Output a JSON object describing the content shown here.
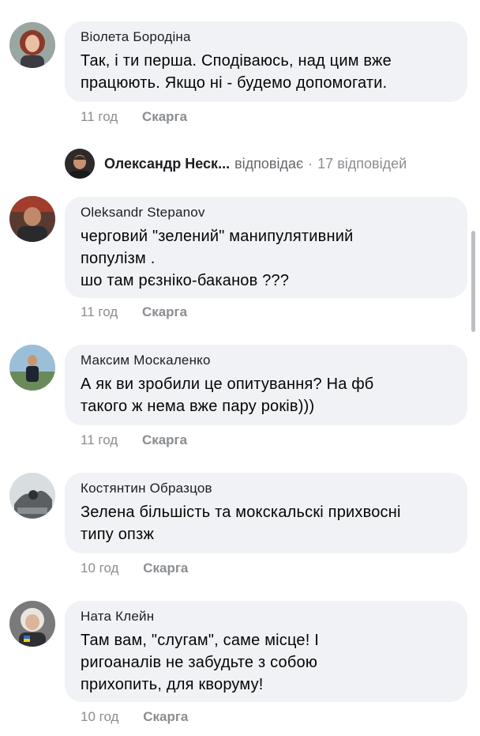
{
  "comments": [
    {
      "author": "Віолета Бородіна",
      "lines": [
        "Так, і ти перша. Сподіваюсь, над цим вже",
        "працюють. Якщо ні - будемо допомогати."
      ],
      "time": "11 год",
      "report": "Скарга"
    },
    {
      "author": "Oleksandr Stepanov",
      "lines": [
        "черговий \"зелений\" манипулятивний",
        "популізм .",
        "шо там рєзніко-баканов ???"
      ],
      "time": "11 год",
      "report": "Скарга"
    },
    {
      "author": "Максим Москаленко",
      "lines": [
        "А як ви зробили це опитування? На фб",
        "такого ж нема вже пару років)))"
      ],
      "time": "11 год",
      "report": "Скарга"
    },
    {
      "author": "Костянтин Образцов",
      "lines": [
        "Зелена більшість та мокскальскі прихвосні",
        "типу опзж"
      ],
      "time": "10 год",
      "report": "Скарга"
    },
    {
      "author": "Ната Клейн",
      "lines": [
        "Там вам, \"слугам\", саме місце! І",
        "ригоаналів не забудьте з собою",
        "прихопить, для кворуму!"
      ],
      "time": "10 год",
      "report": "Скарга"
    }
  ],
  "replies": {
    "name": "Олександр Неск...",
    "action": "відповідає",
    "separator": "·",
    "count": "17 відповідей"
  },
  "colors": {
    "bubble": "#f0f2f5",
    "meta": "#8a8d91",
    "text": "#050505"
  }
}
